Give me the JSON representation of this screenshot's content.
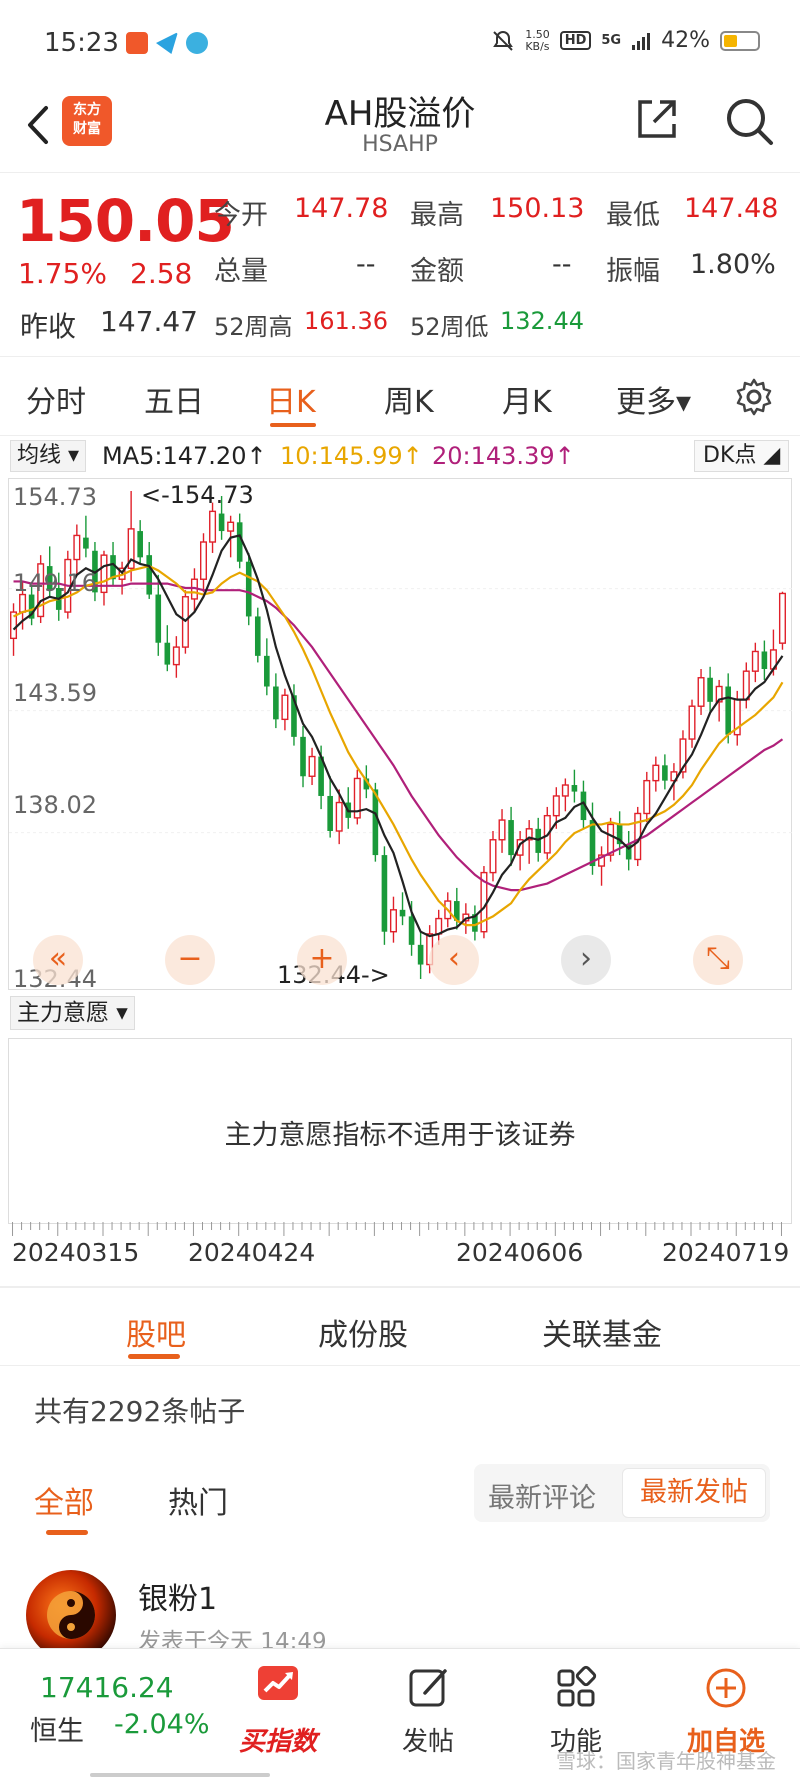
{
  "status_bar": {
    "time": "15:23",
    "net_speed_value": "1.50",
    "net_speed_unit": "KB/s",
    "hd": "HD",
    "signal": "5G",
    "battery": "42%",
    "battery_level": 0.42,
    "icons": [
      "notification-app-icon",
      "telegram-icon",
      "weather-icon",
      "mute-icon",
      "signal-icon",
      "battery-icon"
    ]
  },
  "nav": {
    "logo_line1": "东方",
    "logo_line2": "财富",
    "title": "AH股溢价",
    "code": "HSAHP",
    "icons": [
      "back-icon",
      "share-icon",
      "search-icon"
    ]
  },
  "quote": {
    "price": "150.05",
    "change_pct": "1.75%",
    "change": "2.58",
    "prev_close_label": "昨收",
    "prev_close": "147.47",
    "open_label": "今开",
    "open": "147.78",
    "high_label": "最高",
    "high": "150.13",
    "low_label": "最低",
    "low": "147.48",
    "volume_label": "总量",
    "volume": "--",
    "amount_label": "金额",
    "amount": "--",
    "amplitude_label": "振幅",
    "amplitude": "1.80%",
    "w52_high_label": "52周高",
    "w52_high": "161.36",
    "w52_low_label": "52周低",
    "w52_low": "132.44"
  },
  "periods": {
    "tabs": [
      "分时",
      "五日",
      "日K",
      "周K",
      "月K",
      "更多▾"
    ],
    "active": "日K"
  },
  "ma": {
    "selector": "均线 ▾",
    "ma5": "MA5:147.20↑",
    "ma10": "10:145.99↑",
    "ma20": "20:143.39↑",
    "dk": "DK点 ◢",
    "colors": {
      "ma5": "#222222",
      "ma10": "#e8a600",
      "ma20": "#b0207a"
    }
  },
  "chart": {
    "y_labels": [
      "154.73",
      "149.16",
      "143.59",
      "138.02",
      "132.44"
    ],
    "max_note": "<-154.73",
    "min_note": "132.44->",
    "controls": [
      "«",
      "−",
      "+",
      "‹",
      "›",
      "⤡"
    ]
  },
  "chart_data": {
    "type": "candlestick",
    "ylim": [
      132.44,
      154.73
    ],
    "x_labels": [
      "20240315",
      "20240424",
      "20240606",
      "20240719"
    ],
    "candles": [
      [
        148.0,
        149.6,
        147.2,
        149.2
      ],
      [
        149.2,
        150.6,
        148.4,
        150.0
      ],
      [
        150.0,
        150.4,
        148.6,
        148.9
      ],
      [
        149.0,
        151.8,
        148.7,
        151.4
      ],
      [
        151.3,
        152.2,
        149.9,
        150.2
      ],
      [
        150.3,
        151.0,
        148.8,
        149.3
      ],
      [
        149.2,
        152.0,
        148.9,
        151.6
      ],
      [
        151.6,
        153.2,
        150.9,
        152.7
      ],
      [
        152.6,
        153.6,
        151.7,
        152.1
      ],
      [
        152.0,
        152.4,
        149.7,
        150.1
      ],
      [
        150.1,
        152.0,
        149.5,
        151.8
      ],
      [
        151.8,
        152.4,
        150.4,
        150.7
      ],
      [
        150.7,
        151.5,
        150.0,
        151.2
      ],
      [
        151.2,
        154.73,
        150.6,
        153.0
      ],
      [
        152.9,
        153.4,
        151.4,
        151.7
      ],
      [
        151.8,
        152.4,
        149.8,
        150.0
      ],
      [
        150.0,
        150.9,
        147.2,
        147.8
      ],
      [
        147.8,
        148.6,
        146.5,
        146.8
      ],
      [
        146.8,
        148.1,
        146.2,
        147.6
      ],
      [
        147.6,
        150.2,
        147.3,
        149.9
      ],
      [
        149.8,
        151.2,
        149.2,
        150.7
      ],
      [
        150.7,
        152.8,
        150.1,
        152.4
      ],
      [
        152.4,
        154.2,
        151.9,
        153.8
      ],
      [
        153.7,
        154.5,
        152.5,
        152.9
      ],
      [
        152.9,
        153.6,
        151.7,
        153.3
      ],
      [
        153.3,
        153.7,
        151.2,
        151.5
      ],
      [
        151.5,
        151.9,
        148.6,
        149.0
      ],
      [
        149.0,
        149.4,
        146.9,
        147.2
      ],
      [
        147.2,
        148.0,
        145.4,
        145.8
      ],
      [
        145.8,
        146.4,
        143.9,
        144.3
      ],
      [
        144.3,
        145.7,
        143.8,
        145.4
      ],
      [
        145.4,
        145.9,
        143.1,
        143.5
      ],
      [
        143.5,
        144.0,
        141.2,
        141.7
      ],
      [
        141.7,
        143.0,
        141.3,
        142.6
      ],
      [
        142.6,
        143.1,
        140.2,
        140.8
      ],
      [
        140.8,
        141.7,
        138.9,
        139.2
      ],
      [
        139.2,
        141.1,
        138.6,
        140.5
      ],
      [
        140.5,
        141.2,
        139.3,
        139.8
      ],
      [
        139.8,
        142.0,
        139.5,
        141.6
      ],
      [
        141.6,
        142.2,
        140.7,
        141.1
      ],
      [
        141.1,
        141.4,
        137.8,
        138.1
      ],
      [
        138.1,
        138.5,
        134.0,
        134.6
      ],
      [
        134.6,
        136.2,
        134.1,
        135.6
      ],
      [
        135.6,
        136.4,
        134.9,
        135.3
      ],
      [
        135.3,
        136.0,
        133.5,
        134.0
      ],
      [
        134.0,
        134.6,
        132.44,
        133.1
      ],
      [
        133.1,
        134.9,
        132.7,
        134.5
      ],
      [
        134.5,
        135.6,
        134.0,
        135.2
      ],
      [
        135.2,
        136.4,
        134.8,
        136.0
      ],
      [
        136.0,
        136.6,
        134.7,
        135.1
      ],
      [
        135.1,
        135.9,
        134.5,
        135.4
      ],
      [
        135.4,
        135.8,
        134.2,
        134.6
      ],
      [
        134.6,
        137.6,
        134.3,
        137.3
      ],
      [
        137.3,
        139.2,
        136.9,
        138.8
      ],
      [
        138.8,
        140.2,
        138.2,
        139.7
      ],
      [
        139.7,
        140.3,
        137.6,
        138.1
      ],
      [
        138.1,
        139.2,
        137.4,
        138.8
      ],
      [
        138.8,
        139.7,
        137.7,
        139.3
      ],
      [
        139.3,
        139.8,
        137.8,
        138.2
      ],
      [
        138.2,
        140.3,
        137.9,
        139.9
      ],
      [
        139.9,
        141.2,
        139.3,
        140.8
      ],
      [
        140.8,
        141.6,
        140.1,
        141.3
      ],
      [
        141.3,
        142.0,
        140.5,
        141.0
      ],
      [
        141.0,
        141.5,
        139.3,
        139.7
      ],
      [
        139.7,
        140.5,
        137.2,
        137.6
      ],
      [
        137.6,
        138.5,
        136.7,
        138.1
      ],
      [
        138.1,
        139.8,
        137.8,
        139.5
      ],
      [
        139.5,
        140.1,
        138.1,
        138.6
      ],
      [
        138.6,
        139.2,
        137.4,
        137.9
      ],
      [
        137.9,
        140.3,
        137.6,
        140.0
      ],
      [
        140.0,
        141.9,
        139.6,
        141.5
      ],
      [
        141.5,
        142.6,
        141.0,
        142.2
      ],
      [
        142.2,
        142.7,
        141.1,
        141.5
      ],
      [
        141.5,
        142.3,
        140.6,
        141.9
      ],
      [
        141.9,
        143.8,
        141.6,
        143.4
      ],
      [
        143.4,
        145.2,
        143.0,
        144.9
      ],
      [
        144.9,
        146.6,
        144.5,
        146.2
      ],
      [
        146.2,
        146.7,
        144.6,
        145.1
      ],
      [
        145.1,
        146.1,
        144.2,
        145.8
      ],
      [
        145.8,
        146.4,
        143.2,
        143.6
      ],
      [
        143.6,
        145.6,
        143.1,
        145.2
      ],
      [
        145.2,
        146.9,
        144.8,
        146.5
      ],
      [
        146.5,
        147.8,
        146.0,
        147.4
      ],
      [
        147.4,
        147.9,
        146.1,
        146.6
      ],
      [
        146.6,
        148.4,
        146.3,
        147.47
      ],
      [
        147.78,
        150.13,
        147.48,
        150.05
      ]
    ],
    "ma5": [
      148.4,
      148.8,
      149.1,
      149.7,
      149.9,
      149.8,
      150.1,
      150.9,
      151.2,
      151.0,
      151.3,
      151.4,
      151.0,
      151.6,
      151.4,
      151.3,
      150.7,
      149.9,
      149.1,
      148.8,
      149.2,
      149.9,
      150.9,
      152.0,
      152.6,
      152.7,
      151.8,
      150.7,
      149.3,
      147.6,
      146.3,
      145.2,
      144.1,
      143.5,
      142.6,
      141.6,
      140.9,
      140.1,
      140.1,
      140.2,
      140.0,
      139.0,
      138.2,
      136.9,
      135.5,
      134.6,
      134.4,
      134.5,
      134.7,
      134.8,
      135.2,
      135.3,
      135.7,
      136.4,
      137.2,
      137.7,
      138.6,
      138.9,
      138.8,
      139.0,
      139.6,
      139.8,
      140.3,
      140.5,
      139.8,
      139.2,
      139.0,
      138.8,
      138.4,
      138.7,
      139.5,
      140.0,
      140.7,
      141.4,
      142.1,
      142.7,
      143.6,
      144.6,
      145.2,
      145.3,
      145.2,
      145.2,
      145.7,
      146.0,
      146.6,
      147.2
    ],
    "ma10": [
      149.0,
      149.2,
      149.3,
      149.5,
      149.7,
      149.8,
      149.9,
      150.1,
      150.4,
      150.5,
      150.6,
      150.8,
      150.9,
      151.1,
      151.2,
      151.3,
      151.1,
      150.8,
      150.5,
      150.1,
      150.1,
      150.0,
      150.1,
      150.5,
      150.8,
      151.0,
      150.8,
      150.6,
      150.2,
      149.6,
      149.0,
      148.3,
      147.5,
      146.6,
      145.6,
      144.6,
      143.7,
      142.8,
      142.1,
      141.5,
      140.9,
      140.2,
      139.5,
      138.7,
      137.9,
      137.2,
      136.6,
      136.0,
      135.6,
      135.1,
      134.9,
      134.9,
      135.1,
      135.3,
      135.6,
      135.9,
      136.5,
      137.0,
      137.4,
      137.8,
      138.2,
      138.7,
      139.1,
      139.3,
      139.5,
      139.5,
      139.6,
      139.5,
      139.5,
      139.6,
      139.7,
      139.9,
      140.1,
      140.4,
      140.8,
      141.3,
      142.0,
      142.6,
      143.2,
      143.6,
      143.9,
      144.2,
      144.5,
      144.9,
      145.3,
      145.99
    ],
    "ma20": [
      150.6,
      150.6,
      150.5,
      150.5,
      150.5,
      150.5,
      150.4,
      150.4,
      150.4,
      150.4,
      150.4,
      150.4,
      150.4,
      150.5,
      150.5,
      150.5,
      150.5,
      150.5,
      150.4,
      150.3,
      150.3,
      150.2,
      150.2,
      150.2,
      150.2,
      150.2,
      150.1,
      149.9,
      149.7,
      149.4,
      149.0,
      148.6,
      148.1,
      147.6,
      147.0,
      146.4,
      145.8,
      145.2,
      144.6,
      144.0,
      143.4,
      142.8,
      142.2,
      141.5,
      140.8,
      140.2,
      139.6,
      139.0,
      138.5,
      138.0,
      137.6,
      137.2,
      136.9,
      136.7,
      136.6,
      136.5,
      136.5,
      136.6,
      136.7,
      136.8,
      137.0,
      137.2,
      137.4,
      137.6,
      137.8,
      138.0,
      138.2,
      138.4,
      138.6,
      138.8,
      139.0,
      139.3,
      139.6,
      139.9,
      140.2,
      140.5,
      140.8,
      141.1,
      141.4,
      141.7,
      142.0,
      142.3,
      142.6,
      142.9,
      143.1,
      143.39
    ]
  },
  "indicator": {
    "selector": "主力意愿 ▾",
    "message": "主力意愿指标不适用于该证券"
  },
  "dates": [
    "20240315",
    "20240424",
    "20240606",
    "20240719"
  ],
  "tabs2": {
    "items": [
      "股吧",
      "成份股",
      "关联基金"
    ],
    "active": "股吧"
  },
  "posts": {
    "count_text": "共有2292条帖子",
    "filter_all": "全部",
    "filter_hot": "热门",
    "sort_comment": "最新评论",
    "sort_post": "最新发帖",
    "items": [
      {
        "user": "银粉1",
        "time": "发表于今天 14:49"
      }
    ]
  },
  "bottom_bar": {
    "index_value": "17416.24",
    "index_name": "恒生",
    "index_change": "-2.04%",
    "items": [
      {
        "label": "买指数",
        "icon": "chart-up-icon"
      },
      {
        "label": "发帖",
        "icon": "edit-icon"
      },
      {
        "label": "功能",
        "icon": "grid-icon"
      },
      {
        "label": "加自选",
        "icon": "plus-circle-icon"
      }
    ],
    "watermark": "雪球：国家青年股神基金"
  }
}
